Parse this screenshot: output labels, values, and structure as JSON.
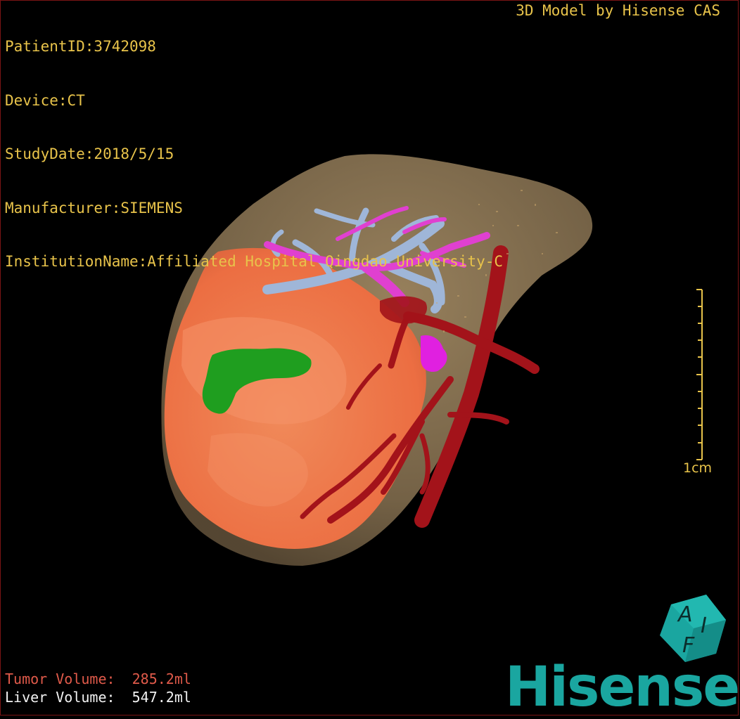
{
  "header": {
    "patient_id": "PatientID:3742098",
    "device": "Device:CT",
    "study_date": "StudyDate:2018/5/15",
    "manufacturer": "Manufacturer:SIEMENS",
    "institution": "InstitutionName:Affiliated Hospital Qingdao University-C"
  },
  "watermark": "3D Model by Hisense CAS",
  "scale_bar": {
    "label": "1cm"
  },
  "volumes": {
    "tumor": "Tumor Volume:  285.2ml",
    "liver": "Liver Volume:  547.2ml"
  },
  "brand": {
    "name": "Hisense",
    "cube_letters": [
      "A",
      "I",
      "F"
    ]
  },
  "colors": {
    "text": "#e8c34a",
    "liver": "#8f7a58",
    "tumor": "#f07a4a",
    "artery": "#a3131a",
    "portal_vein": "#9fb6d8",
    "hepatic_vein": "#e040d0",
    "lesion": "#1f9e1f",
    "brand": "#1aa6a0",
    "frame": "#7a1414"
  }
}
